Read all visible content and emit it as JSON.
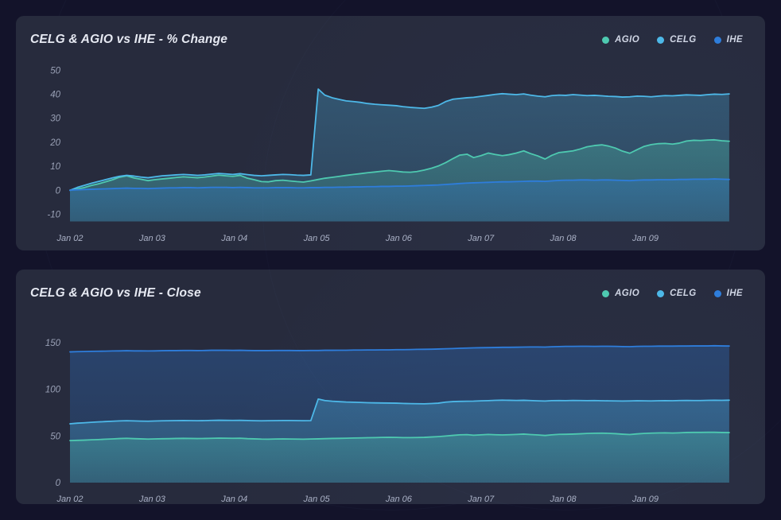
{
  "page": {
    "background_color": "#13132a",
    "card_color": "#272b3d"
  },
  "series_colors": {
    "AGIO": "#4ec9b0",
    "CELG": "#4db8e8",
    "IHE": "#2e7ddb"
  },
  "charts": [
    {
      "id": "pct-change",
      "title": "CELG & AGIO vs IHE - % Change",
      "legend": [
        {
          "label": "AGIO",
          "color": "#4ec9b0",
          "icon": "legend-dot-icon"
        },
        {
          "label": "CELG",
          "color": "#4db8e8",
          "icon": "legend-dot-icon"
        },
        {
          "label": "IHE",
          "color": "#2e7ddb",
          "icon": "legend-dot-icon"
        }
      ],
      "yticks": [
        "50",
        "40",
        "30",
        "20",
        "10",
        "0",
        "-10"
      ],
      "xticks": [
        "Jan 02",
        "Jan 03",
        "Jan 04",
        "Jan 05",
        "Jan 06",
        "Jan 07",
        "Jan 08",
        "Jan 09"
      ]
    },
    {
      "id": "close",
      "title": "CELG & AGIO vs IHE - Close",
      "legend": [
        {
          "label": "AGIO",
          "color": "#4ec9b0",
          "icon": "legend-dot-icon"
        },
        {
          "label": "CELG",
          "color": "#4db8e8",
          "icon": "legend-dot-icon"
        },
        {
          "label": "IHE",
          "color": "#2e7ddb",
          "icon": "legend-dot-icon"
        }
      ],
      "yticks": [
        "150",
        "100",
        "50",
        "0"
      ],
      "xticks": [
        "Jan 02",
        "Jan 03",
        "Jan 04",
        "Jan 05",
        "Jan 06",
        "Jan 07",
        "Jan 08",
        "Jan 09"
      ]
    }
  ],
  "chart_data": [
    {
      "type": "area",
      "id": "pct-change",
      "title": "CELG & AGIO vs IHE - % Change",
      "xlabel": "",
      "ylabel": "",
      "ylim": [
        -13,
        54
      ],
      "xlim": [
        0,
        8.05
      ],
      "grid": false,
      "legend_position": "top-right",
      "yticks": [
        50,
        40,
        30,
        20,
        10,
        0,
        -10
      ],
      "xtick_positions": [
        0,
        1,
        2,
        3,
        4,
        5,
        6,
        7
      ],
      "xtick_labels": [
        "Jan 02",
        "Jan 03",
        "Jan 04",
        "Jan 05",
        "Jan 06",
        "Jan 07",
        "Jan 08",
        "Jan 09"
      ],
      "x": [
        0.0,
        0.09,
        0.17,
        0.26,
        0.34,
        0.43,
        0.52,
        0.6,
        0.69,
        0.78,
        0.86,
        0.95,
        1.03,
        1.12,
        1.21,
        1.29,
        1.38,
        1.47,
        1.55,
        1.64,
        1.72,
        1.81,
        1.9,
        1.98,
        2.07,
        2.16,
        2.24,
        2.33,
        2.41,
        2.5,
        2.59,
        2.67,
        2.76,
        2.84,
        2.93,
        3.02,
        3.1,
        3.19,
        3.28,
        3.36,
        3.45,
        3.53,
        3.62,
        3.71,
        3.79,
        3.88,
        3.97,
        4.05,
        4.14,
        4.22,
        4.31,
        4.4,
        4.48,
        4.57,
        4.66,
        4.74,
        4.83,
        4.91,
        5.0,
        5.09,
        5.17,
        5.26,
        5.34,
        5.43,
        5.52,
        5.6,
        5.69,
        5.78,
        5.86,
        5.95,
        6.03,
        6.12,
        6.21,
        6.29,
        6.38,
        6.47,
        6.55,
        6.64,
        6.72,
        6.81,
        6.9,
        6.98,
        7.07,
        7.16,
        7.24,
        7.33,
        7.41,
        7.5,
        7.59,
        7.67,
        7.76,
        7.84,
        7.93,
        8.02
      ],
      "series": [
        {
          "name": "AGIO",
          "color": "#4ec9b0",
          "values": [
            0.0,
            0.6,
            1.1,
            2.0,
            2.6,
            3.5,
            4.4,
            5.4,
            6.0,
            5.1,
            4.6,
            4.0,
            4.4,
            4.7,
            5.0,
            5.3,
            5.6,
            5.4,
            5.2,
            5.5,
            5.9,
            6.3,
            6.0,
            5.8,
            6.2,
            5.0,
            4.4,
            3.6,
            3.5,
            4.0,
            4.2,
            3.9,
            3.6,
            3.4,
            3.9,
            4.5,
            5.0,
            5.4,
            5.8,
            6.2,
            6.6,
            6.9,
            7.3,
            7.6,
            7.9,
            8.2,
            7.9,
            7.6,
            7.5,
            7.8,
            8.4,
            9.2,
            10.1,
            11.5,
            13.2,
            14.6,
            15.0,
            13.6,
            14.4,
            15.5,
            14.9,
            14.4,
            14.8,
            15.5,
            16.4,
            15.3,
            14.3,
            13.0,
            14.5,
            15.7,
            16.0,
            16.4,
            17.2,
            18.1,
            18.6,
            18.9,
            18.4,
            17.5,
            16.3,
            15.4,
            16.9,
            18.2,
            19.0,
            19.4,
            19.5,
            19.2,
            19.6,
            20.5,
            20.8,
            20.7,
            20.9,
            21.0,
            20.6,
            20.4
          ]
        },
        {
          "name": "CELG",
          "color": "#4db8e8",
          "values": [
            0.0,
            1.2,
            2.0,
            2.9,
            3.6,
            4.4,
            5.2,
            5.8,
            6.2,
            5.9,
            5.5,
            5.2,
            5.6,
            6.0,
            6.2,
            6.4,
            6.6,
            6.4,
            6.2,
            6.4,
            6.7,
            7.0,
            6.8,
            6.6,
            6.9,
            6.5,
            6.2,
            6.0,
            6.2,
            6.4,
            6.6,
            6.5,
            6.3,
            6.2,
            6.4,
            42.1,
            39.6,
            38.5,
            37.8,
            37.2,
            36.9,
            36.6,
            36.1,
            35.8,
            35.6,
            35.4,
            35.2,
            34.8,
            34.5,
            34.3,
            34.1,
            34.6,
            35.3,
            36.9,
            37.9,
            38.2,
            38.5,
            38.7,
            39.1,
            39.5,
            39.9,
            40.2,
            40.0,
            39.8,
            40.1,
            39.6,
            39.2,
            38.9,
            39.4,
            39.6,
            39.5,
            39.8,
            39.6,
            39.4,
            39.5,
            39.3,
            39.1,
            39.0,
            38.8,
            38.9,
            39.2,
            39.1,
            38.9,
            39.2,
            39.4,
            39.3,
            39.5,
            39.7,
            39.6,
            39.5,
            39.8,
            40.0,
            39.9,
            40.1
          ]
        },
        {
          "name": "IHE",
          "color": "#2e7ddb",
          "values": [
            0.0,
            0.2,
            0.3,
            0.4,
            0.5,
            0.6,
            0.7,
            0.8,
            0.9,
            0.8,
            0.8,
            0.7,
            0.8,
            0.9,
            1.0,
            1.0,
            1.1,
            1.1,
            1.0,
            1.1,
            1.2,
            1.2,
            1.2,
            1.1,
            1.2,
            1.1,
            1.0,
            1.0,
            1.0,
            1.1,
            1.1,
            1.1,
            1.0,
            1.0,
            1.1,
            1.1,
            1.2,
            1.2,
            1.3,
            1.3,
            1.4,
            1.4,
            1.5,
            1.5,
            1.6,
            1.6,
            1.7,
            1.7,
            1.8,
            1.9,
            2.0,
            2.1,
            2.2,
            2.4,
            2.6,
            2.8,
            3.0,
            3.1,
            3.2,
            3.3,
            3.4,
            3.5,
            3.5,
            3.6,
            3.7,
            3.8,
            3.8,
            3.7,
            3.9,
            4.1,
            4.2,
            4.2,
            4.3,
            4.3,
            4.2,
            4.3,
            4.3,
            4.2,
            4.1,
            4.0,
            4.2,
            4.3,
            4.3,
            4.4,
            4.4,
            4.4,
            4.5,
            4.5,
            4.6,
            4.6,
            4.6,
            4.7,
            4.6,
            4.5
          ]
        }
      ]
    },
    {
      "type": "area",
      "id": "close",
      "title": "CELG & AGIO vs IHE - Close",
      "xlabel": "",
      "ylabel": "",
      "ylim": [
        0,
        172
      ],
      "xlim": [
        0,
        8.05
      ],
      "grid": false,
      "legend_position": "top-right",
      "yticks": [
        150,
        100,
        50,
        0
      ],
      "xtick_positions": [
        0,
        1,
        2,
        3,
        4,
        5,
        6,
        7
      ],
      "xtick_labels": [
        "Jan 02",
        "Jan 03",
        "Jan 04",
        "Jan 05",
        "Jan 06",
        "Jan 07",
        "Jan 08",
        "Jan 09"
      ],
      "x": [
        0.0,
        0.09,
        0.17,
        0.26,
        0.34,
        0.43,
        0.52,
        0.6,
        0.69,
        0.78,
        0.86,
        0.95,
        1.03,
        1.12,
        1.21,
        1.29,
        1.38,
        1.47,
        1.55,
        1.64,
        1.72,
        1.81,
        1.9,
        1.98,
        2.07,
        2.16,
        2.24,
        2.33,
        2.41,
        2.5,
        2.59,
        2.67,
        2.76,
        2.84,
        2.93,
        3.02,
        3.1,
        3.19,
        3.28,
        3.36,
        3.45,
        3.53,
        3.62,
        3.71,
        3.79,
        3.88,
        3.97,
        4.05,
        4.14,
        4.22,
        4.31,
        4.4,
        4.48,
        4.57,
        4.66,
        4.74,
        4.83,
        4.91,
        5.0,
        5.09,
        5.17,
        5.26,
        5.34,
        5.43,
        5.52,
        5.6,
        5.69,
        5.78,
        5.86,
        5.95,
        6.03,
        6.12,
        6.21,
        6.29,
        6.38,
        6.47,
        6.55,
        6.64,
        6.72,
        6.81,
        6.9,
        6.98,
        7.07,
        7.16,
        7.24,
        7.33,
        7.41,
        7.5,
        7.59,
        7.67,
        7.76,
        7.84,
        7.93,
        8.02
      ],
      "series": [
        {
          "name": "AGIO",
          "color": "#4ec9b0",
          "values": [
            45.0,
            45.3,
            45.5,
            45.9,
            46.1,
            46.5,
            46.8,
            47.2,
            47.5,
            47.1,
            46.9,
            46.6,
            46.8,
            47.0,
            47.1,
            47.3,
            47.4,
            47.3,
            47.2,
            47.3,
            47.5,
            47.7,
            47.6,
            47.5,
            47.6,
            47.1,
            46.9,
            46.6,
            46.5,
            46.7,
            46.8,
            46.7,
            46.6,
            46.5,
            46.7,
            46.9,
            47.1,
            47.3,
            47.4,
            47.6,
            47.8,
            47.9,
            48.1,
            48.2,
            48.4,
            48.5,
            48.4,
            48.2,
            48.2,
            48.3,
            48.5,
            48.9,
            49.3,
            49.9,
            50.6,
            51.2,
            51.4,
            50.8,
            51.2,
            51.6,
            51.3,
            51.1,
            51.3,
            51.6,
            52.0,
            51.5,
            51.1,
            50.5,
            51.2,
            51.7,
            51.8,
            52.0,
            52.3,
            52.7,
            52.9,
            53.0,
            52.8,
            52.4,
            51.9,
            51.5,
            52.2,
            52.7,
            53.0,
            53.2,
            53.3,
            53.1,
            53.3,
            53.7,
            53.8,
            53.8,
            53.9,
            53.9,
            53.7,
            53.6
          ]
        },
        {
          "name": "CELG",
          "color": "#4db8e8",
          "values": [
            63.0,
            63.7,
            64.1,
            64.6,
            65.0,
            65.4,
            65.8,
            66.1,
            66.3,
            66.1,
            65.9,
            65.8,
            66.0,
            66.2,
            66.3,
            66.4,
            66.5,
            66.4,
            66.3,
            66.4,
            66.6,
            66.8,
            66.7,
            66.6,
            66.7,
            66.5,
            66.3,
            66.2,
            66.3,
            66.4,
            66.5,
            66.5,
            66.4,
            66.3,
            66.4,
            89.5,
            87.9,
            87.2,
            86.7,
            86.3,
            86.1,
            85.9,
            85.6,
            85.4,
            85.3,
            85.2,
            85.1,
            84.8,
            84.6,
            84.5,
            84.4,
            84.7,
            85.1,
            86.2,
            86.8,
            87.0,
            87.2,
            87.3,
            87.6,
            87.8,
            88.1,
            88.3,
            88.2,
            88.0,
            88.2,
            87.9,
            87.6,
            87.4,
            87.8,
            87.9,
            87.8,
            88.0,
            87.9,
            87.8,
            87.9,
            87.7,
            87.6,
            87.5,
            87.4,
            87.5,
            87.7,
            87.6,
            87.5,
            87.7,
            87.8,
            87.7,
            87.9,
            88.0,
            87.9,
            87.9,
            88.1,
            88.2,
            88.1,
            88.3
          ]
        },
        {
          "name": "IHE",
          "color": "#2e7ddb",
          "values": [
            140.0,
            140.3,
            140.4,
            140.6,
            140.7,
            140.8,
            141.0,
            141.1,
            141.3,
            141.1,
            141.1,
            141.0,
            141.1,
            141.3,
            141.4,
            141.4,
            141.5,
            141.5,
            141.4,
            141.5,
            141.7,
            141.7,
            141.7,
            141.6,
            141.7,
            141.5,
            141.4,
            141.4,
            141.4,
            141.5,
            141.5,
            141.5,
            141.4,
            141.4,
            141.5,
            141.5,
            141.7,
            141.7,
            141.8,
            141.8,
            142.0,
            142.0,
            142.1,
            142.1,
            142.2,
            142.2,
            142.4,
            142.4,
            142.5,
            142.7,
            142.8,
            142.9,
            143.1,
            143.4,
            143.6,
            143.9,
            144.1,
            144.3,
            144.5,
            144.6,
            144.7,
            144.9,
            144.9,
            145.0,
            145.2,
            145.3,
            145.3,
            145.2,
            145.5,
            145.7,
            145.9,
            145.9,
            146.0,
            146.0,
            145.9,
            146.0,
            146.0,
            145.9,
            145.7,
            145.6,
            145.9,
            146.0,
            146.0,
            146.2,
            146.2,
            146.2,
            146.3,
            146.3,
            146.4,
            146.4,
            146.4,
            146.6,
            146.4,
            146.3
          ]
        }
      ]
    }
  ]
}
